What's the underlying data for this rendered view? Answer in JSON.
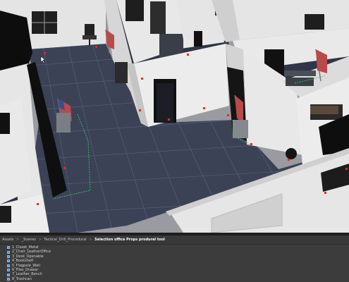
{
  "breadcrumb": {
    "items": [
      "Assets",
      "_Scenes",
      "Tactical_Drill_Procedural"
    ],
    "current": "Selection office Props produral tool",
    "separator": ">"
  },
  "assets": [
    {
      "label": "1_Closet_Metal"
    },
    {
      "label": "2_Chair_LeatherOffice"
    },
    {
      "label": "3_Desk_Openable"
    },
    {
      "label": "4_Bookshelf"
    },
    {
      "label": "5_Flagpole_Wall"
    },
    {
      "label": "6_Files_Drawer"
    },
    {
      "label": "7_Leather_Bench"
    },
    {
      "label": "8_Trashcan"
    }
  ],
  "colors": {
    "floor": "#3b4256",
    "grid": "#566079",
    "wall_face": "#ebebeb",
    "wall_side": "#c9c9c9",
    "wall_top": "#d8d8d8",
    "door": "#141414",
    "waypoint": "#ff2020",
    "path": "#3ec85a",
    "panel": "#3c3c3c"
  },
  "icons": {
    "asset": "prefab-cube-icon",
    "cursor": "mouse-pointer-icon"
  }
}
